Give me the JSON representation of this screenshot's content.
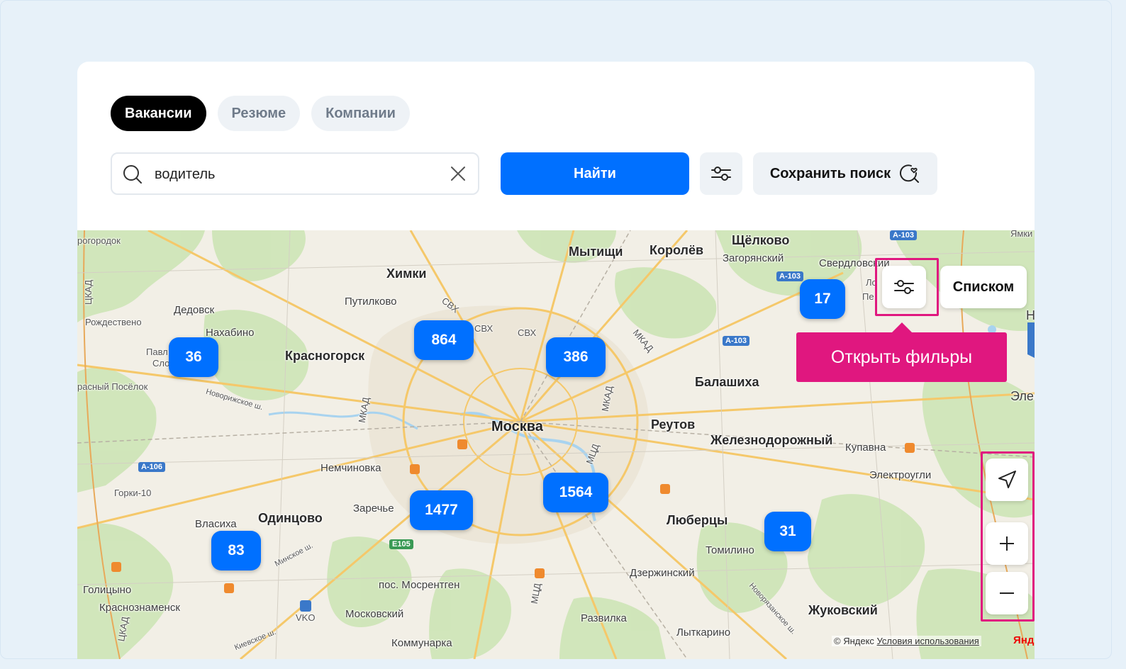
{
  "tabs": [
    {
      "label": "Вакансии",
      "active": true
    },
    {
      "label": "Резюме",
      "active": false
    },
    {
      "label": "Компании",
      "active": false
    }
  ],
  "search": {
    "value": "водитель",
    "find_label": "Найти",
    "save_label": "Сохранить поиск"
  },
  "map": {
    "labels": {
      "moscow": "Москва",
      "mytishchi": "Мытищи",
      "korolev": "Королёв",
      "shchelkovo": "Щёлково",
      "zagoryansky": "Загорянский",
      "sverdlovsky": "Свердловский",
      "khimki": "Химки",
      "putilkovo": "Путилково",
      "dedovsk": "Дедовск",
      "rozhdestveno": "Рождествено",
      "nakhabino": "Нахабино",
      "krasnogorsk": "Красногорск",
      "krasny_posyolok": "расный Посёлок",
      "pavl": "Павл",
      "slo": "Сло",
      "balashikha": "Балашиха",
      "reutov": "Реутов",
      "zheleznodorozhny": "Железнодорожный",
      "kupavna": "Купавна",
      "elektrougli": "Электроугли",
      "ele": "Эле",
      "n": "Н",
      "nemchinovka": "Немчиновка",
      "gorki10": "Горки-10",
      "zarechye": "Заречье",
      "vlasikha": "Власиха",
      "odintsovo": "Одинцово",
      "lyubertsy": "Люберцы",
      "tomilino": "Томилино",
      "dzerzhinsky": "Дзержинский",
      "golitsyno": "Голицыно",
      "krasnoznamensk": "Краснознаменск",
      "mosrentgen": "пос. Мосрентген",
      "moskovsky": "Московский",
      "razvilka": "Развилка",
      "lytkarino": "Лыткарино",
      "zhukovsky": "Жуковский",
      "kommunarka": "Коммунарка",
      "vko": "VKO",
      "rogorodok": "рогородок",
      "yamki": "Ямки",
      "pe": "Пе",
      "lo": "Ло",
      "svx1": "СВХ",
      "svx2": "СВХ",
      "svx3": "СВХ",
      "mkad1": "МКАД",
      "mkad2": "МКАД",
      "mkad3": "МКАД",
      "mcd1": "МЦД",
      "mcd2": "МЦД",
      "tsad": "ЦКАД",
      "tsad2": "ЦКАД",
      "novorizhskoe": "Новорижское ш.",
      "minskoe": "Минское ш.",
      "kievskoe": "Киевское ш.",
      "novoryazanskoe": "Новорязанское ш.",
      "a103_1": "A-103",
      "a103_2": "A-103",
      "a103_3": "A-103",
      "a106": "A-106",
      "e105": "E105"
    },
    "clusters": [
      "36",
      "864",
      "386",
      "17",
      "1477",
      "1564",
      "83",
      "31"
    ],
    "list_label": "Списком",
    "tooltip": "Открыть фильры",
    "copyright": "© Яндекс",
    "terms": "Условия использования",
    "logo": "Янд"
  },
  "colors": {
    "accent": "#0070ff",
    "highlight": "#e0177f",
    "tab_active": "#000000",
    "button_bg": "#eef2f6"
  }
}
